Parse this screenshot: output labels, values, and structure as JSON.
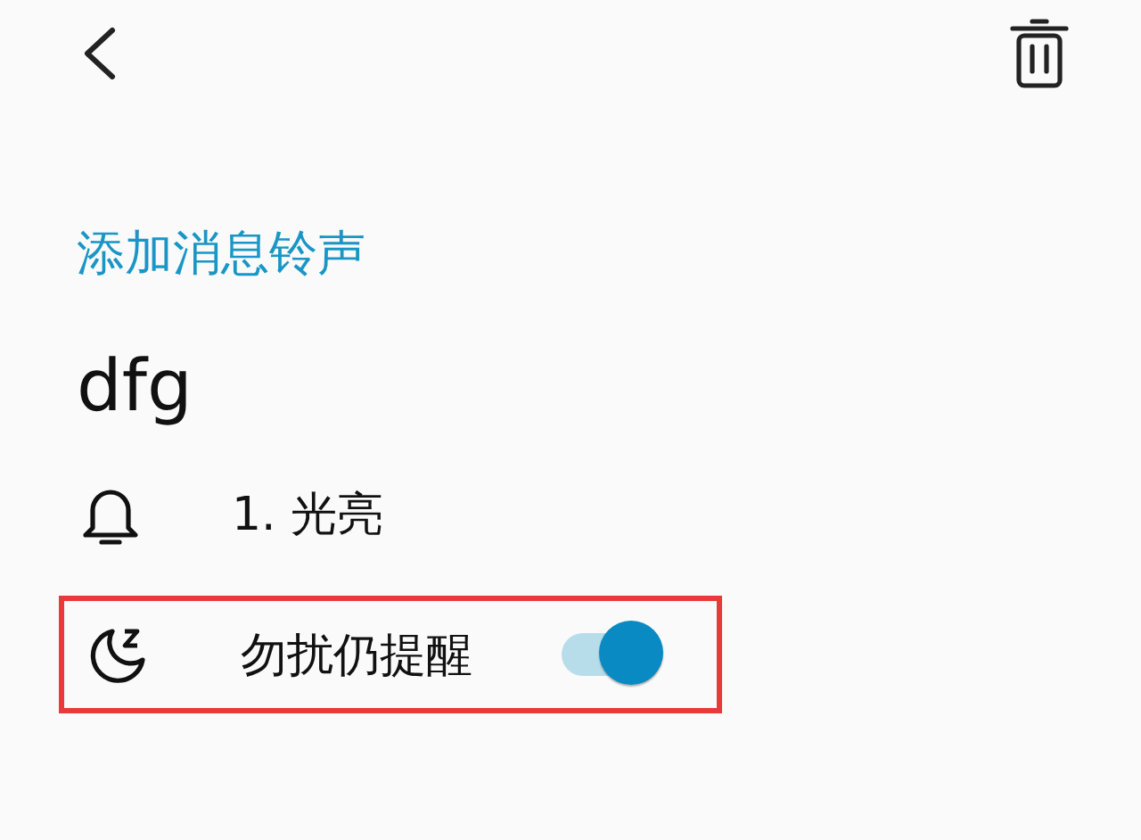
{
  "section_title": "添加消息铃声",
  "name": "dfg",
  "ringtone": {
    "label": "1. 光亮"
  },
  "dnd": {
    "label": "勿扰仍提醒",
    "on": true,
    "highlighted": true
  }
}
